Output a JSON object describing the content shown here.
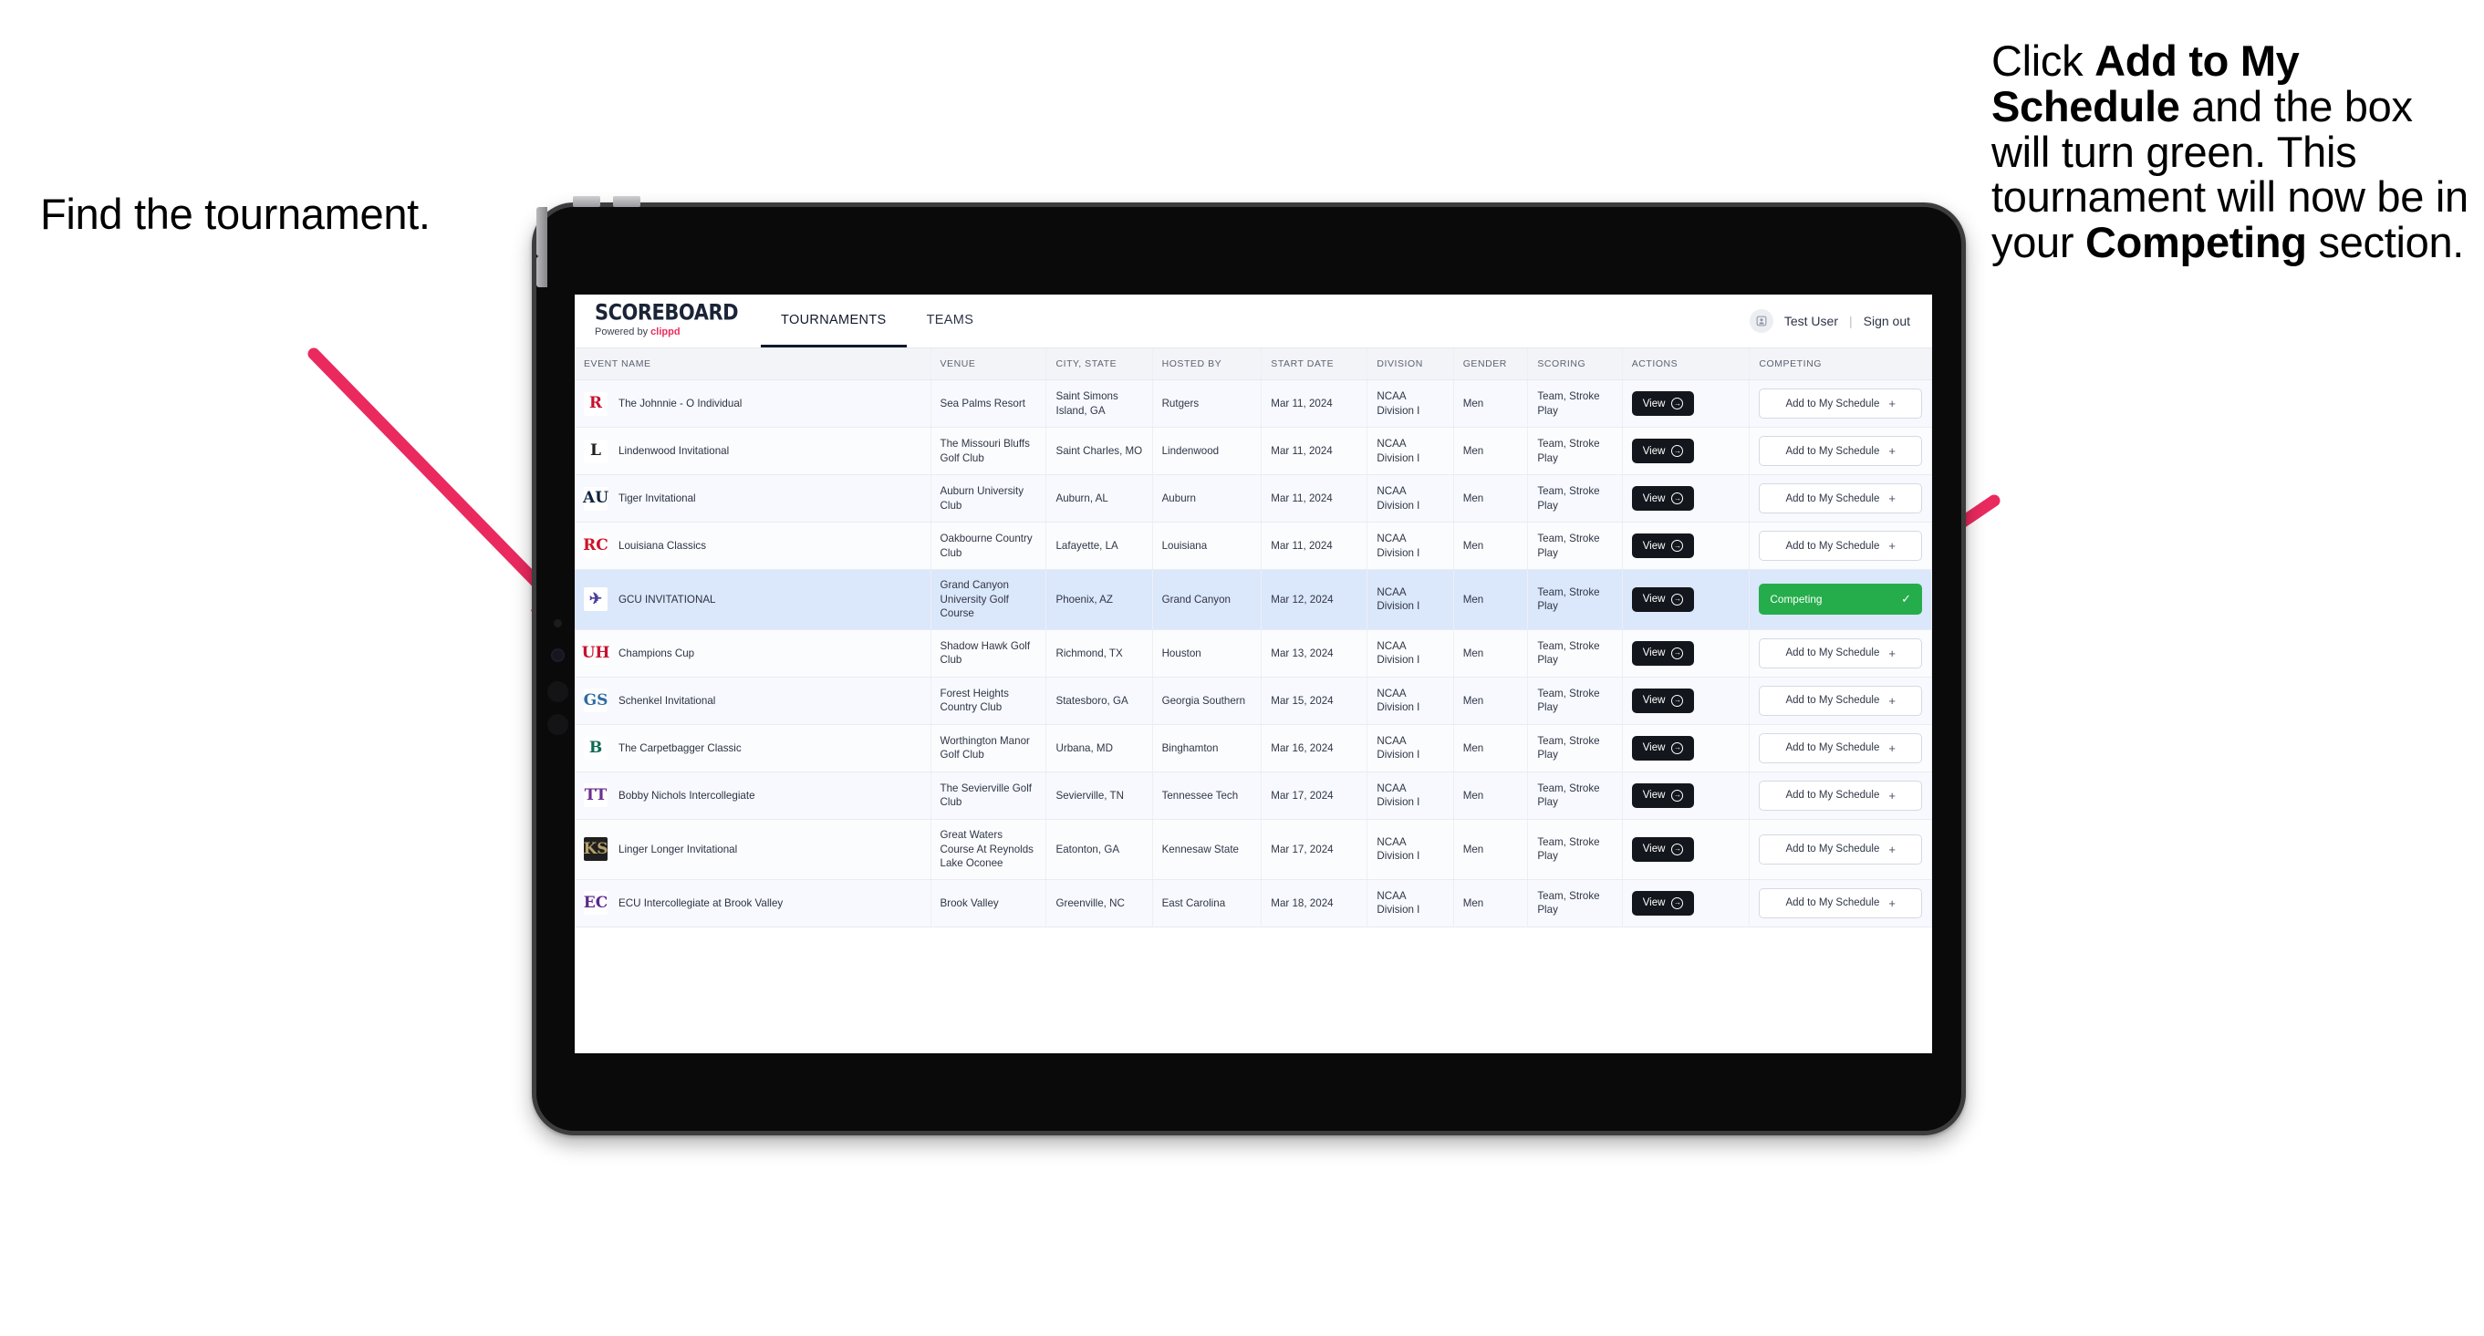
{
  "annotations": {
    "left": "Find the tournament.",
    "right_parts": [
      {
        "text": "Click ",
        "bold": false
      },
      {
        "text": "Add to My Schedule",
        "bold": true
      },
      {
        "text": " and the box will turn green. This tournament will now be in your ",
        "bold": false
      },
      {
        "text": "Competing",
        "bold": true
      },
      {
        "text": " section.",
        "bold": false
      }
    ],
    "arrow_color": "#ea2a5f"
  },
  "app": {
    "brand": {
      "name": "SCOREBOARD",
      "powered_prefix": "Powered by ",
      "powered_brand": "clippd"
    },
    "tabs": [
      {
        "label": "TOURNAMENTS",
        "active": true
      },
      {
        "label": "TEAMS",
        "active": false
      }
    ],
    "header_right": {
      "avatar_icon": "user-avatar-icon",
      "user_name": "Test User",
      "separator": "|",
      "sign_out": "Sign out"
    },
    "table": {
      "columns": [
        "EVENT NAME",
        "VENUE",
        "CITY, STATE",
        "HOSTED BY",
        "START DATE",
        "DIVISION",
        "GENDER",
        "SCORING",
        "ACTIONS",
        "COMPETING"
      ],
      "action_label": "View",
      "add_label": "Add to My Schedule",
      "add_icon": "plus-icon",
      "competing_label": "Competing",
      "competing_icon": "check-icon",
      "view_icon": "arrow-circle-right-icon",
      "rows": [
        {
          "logo_text": "R",
          "logo_fg": "#c8102e",
          "logo_bg": "#ffffff",
          "event": "The Johnnie - O Individual",
          "venue": "Sea Palms Resort",
          "city": "Saint Simons Island, GA",
          "host": "Rutgers",
          "date": "Mar 11, 2024",
          "division": "NCAA Division I",
          "gender": "Men",
          "scoring": "Team, Stroke Play",
          "competing": false
        },
        {
          "logo_text": "L",
          "logo_fg": "#1f1f1f",
          "logo_bg": "#ffffff",
          "event": "Lindenwood Invitational",
          "venue": "The Missouri Bluffs Golf Club",
          "city": "Saint Charles, MO",
          "host": "Lindenwood",
          "date": "Mar 11, 2024",
          "division": "NCAA Division I",
          "gender": "Men",
          "scoring": "Team, Stroke Play",
          "competing": false
        },
        {
          "logo_text": "AU",
          "logo_fg": "#0c2340",
          "logo_bg": "#ffffff",
          "event": "Tiger Invitational",
          "venue": "Auburn University Club",
          "city": "Auburn, AL",
          "host": "Auburn",
          "date": "Mar 11, 2024",
          "division": "NCAA Division I",
          "gender": "Men",
          "scoring": "Team, Stroke Play",
          "competing": false
        },
        {
          "logo_text": "RC",
          "logo_fg": "#ce1126",
          "logo_bg": "#ffffff",
          "event": "Louisiana Classics",
          "venue": "Oakbourne Country Club",
          "city": "Lafayette, LA",
          "host": "Louisiana",
          "date": "Mar 11, 2024",
          "division": "NCAA Division I",
          "gender": "Men",
          "scoring": "Team, Stroke Play",
          "competing": false
        },
        {
          "logo_text": "✈",
          "logo_fg": "#4b3f9e",
          "logo_bg": "#ffffff",
          "event": "GCU INVITATIONAL",
          "venue": "Grand Canyon University Golf Course",
          "city": "Phoenix, AZ",
          "host": "Grand Canyon",
          "date": "Mar 12, 2024",
          "division": "NCAA Division I",
          "gender": "Men",
          "scoring": "Team, Stroke Play",
          "competing": true
        },
        {
          "logo_text": "UH",
          "logo_fg": "#c8102e",
          "logo_bg": "#ffffff",
          "event": "Champions Cup",
          "venue": "Shadow Hawk Golf Club",
          "city": "Richmond, TX",
          "host": "Houston",
          "date": "Mar 13, 2024",
          "division": "NCAA Division I",
          "gender": "Men",
          "scoring": "Team, Stroke Play",
          "competing": false
        },
        {
          "logo_text": "GS",
          "logo_fg": "#2d6ca2",
          "logo_bg": "#ffffff",
          "event": "Schenkel Invitational",
          "venue": "Forest Heights Country Club",
          "city": "Statesboro, GA",
          "host": "Georgia Southern",
          "date": "Mar 15, 2024",
          "division": "NCAA Division I",
          "gender": "Men",
          "scoring": "Team, Stroke Play",
          "competing": false
        },
        {
          "logo_text": "B",
          "logo_fg": "#0d6b52",
          "logo_bg": "#ffffff",
          "event": "The Carpetbagger Classic",
          "venue": "Worthington Manor Golf Club",
          "city": "Urbana, MD",
          "host": "Binghamton",
          "date": "Mar 16, 2024",
          "division": "NCAA Division I",
          "gender": "Men",
          "scoring": "Team, Stroke Play",
          "competing": false
        },
        {
          "logo_text": "TT",
          "logo_fg": "#6b2f91",
          "logo_bg": "#ffffff",
          "event": "Bobby Nichols Intercollegiate",
          "venue": "The Sevierville Golf Club",
          "city": "Sevierville, TN",
          "host": "Tennessee Tech",
          "date": "Mar 17, 2024",
          "division": "NCAA Division I",
          "gender": "Men",
          "scoring": "Team, Stroke Play",
          "competing": false
        },
        {
          "logo_text": "KS",
          "logo_fg": "#b5a169",
          "logo_bg": "#1f1f1f",
          "event": "Linger Longer Invitational",
          "venue": "Great Waters Course At Reynolds Lake Oconee",
          "city": "Eatonton, GA",
          "host": "Kennesaw State",
          "date": "Mar 17, 2024",
          "division": "NCAA Division I",
          "gender": "Men",
          "scoring": "Team, Stroke Play",
          "competing": false
        },
        {
          "logo_text": "EC",
          "logo_fg": "#592a8a",
          "logo_bg": "#ffffff",
          "event": "ECU Intercollegiate at Brook Valley",
          "venue": "Brook Valley",
          "city": "Greenville, NC",
          "host": "East Carolina",
          "date": "Mar 18, 2024",
          "division": "NCAA Division I",
          "gender": "Men",
          "scoring": "Team, Stroke Play",
          "competing": false
        }
      ]
    }
  }
}
